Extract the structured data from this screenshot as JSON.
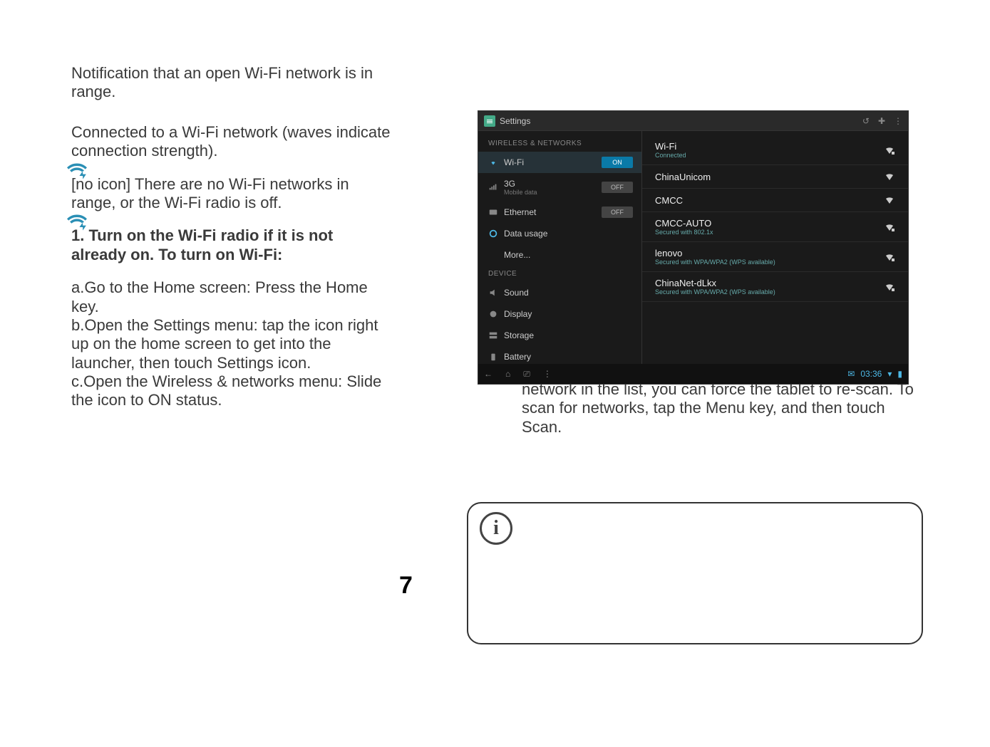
{
  "left": {
    "notification": "Notification that an open Wi-Fi network is in range.",
    "connected": "Connected to a Wi-Fi network (waves indicate connection strength).",
    "none": "[no icon] There are no Wi-Fi networks in range, or the Wi-Fi radio is off.",
    "step1_heading": "1. Turn on the Wi-Fi radio if it is not already on. To turn on Wi-Fi:",
    "step_a": "a.Go to the Home screen: Press the Home key.",
    "step_b": "b.Open the Settings menu: tap the icon right up on the home screen to get into the launcher, then touch Settings icon.",
    "step_c": "c.Open the Wireless & networks menu: Slide the icon to ON status."
  },
  "right": {
    "continuation": "network in the list, you can force the tablet to re-scan. To scan for networks, tap the Menu key, and then touch Scan."
  },
  "page_number": "7",
  "info_icon_label": "i",
  "screenshot": {
    "title": "Settings",
    "topbar_icons": [
      "↺",
      "✚",
      "⋮"
    ],
    "sidebar_header": "WIRELESS & NETWORKS",
    "sidebar_items": [
      {
        "label": "Wi-Fi",
        "toggle": "ON"
      },
      {
        "label": "3G",
        "sub": "Mobile data",
        "toggle": "OFF"
      },
      {
        "label": "Ethernet",
        "toggle": "OFF"
      },
      {
        "label": "Data usage"
      },
      {
        "label": "More..."
      }
    ],
    "sidebar_header2": "DEVICE",
    "sidebar_items2": [
      {
        "label": "Sound"
      },
      {
        "label": "Display"
      },
      {
        "label": "Storage"
      },
      {
        "label": "Battery"
      }
    ],
    "networks": [
      {
        "name": "Wi-Fi",
        "sub": "Connected",
        "locked": true
      },
      {
        "name": "ChinaUnicom",
        "sub": "",
        "locked": false
      },
      {
        "name": "CMCC",
        "sub": "",
        "locked": false
      },
      {
        "name": "CMCC-AUTO",
        "sub": "Secured with 802.1x",
        "locked": true
      },
      {
        "name": "lenovo",
        "sub": "Secured with WPA/WPA2 (WPS available)",
        "locked": true
      },
      {
        "name": "ChinaNet-dLkx",
        "sub": "Secured with WPA/WPA2 (WPS available)",
        "locked": true
      }
    ],
    "time": "03:36",
    "nav_icons": [
      "←",
      "⌂",
      "⎚",
      "⋮"
    ]
  }
}
